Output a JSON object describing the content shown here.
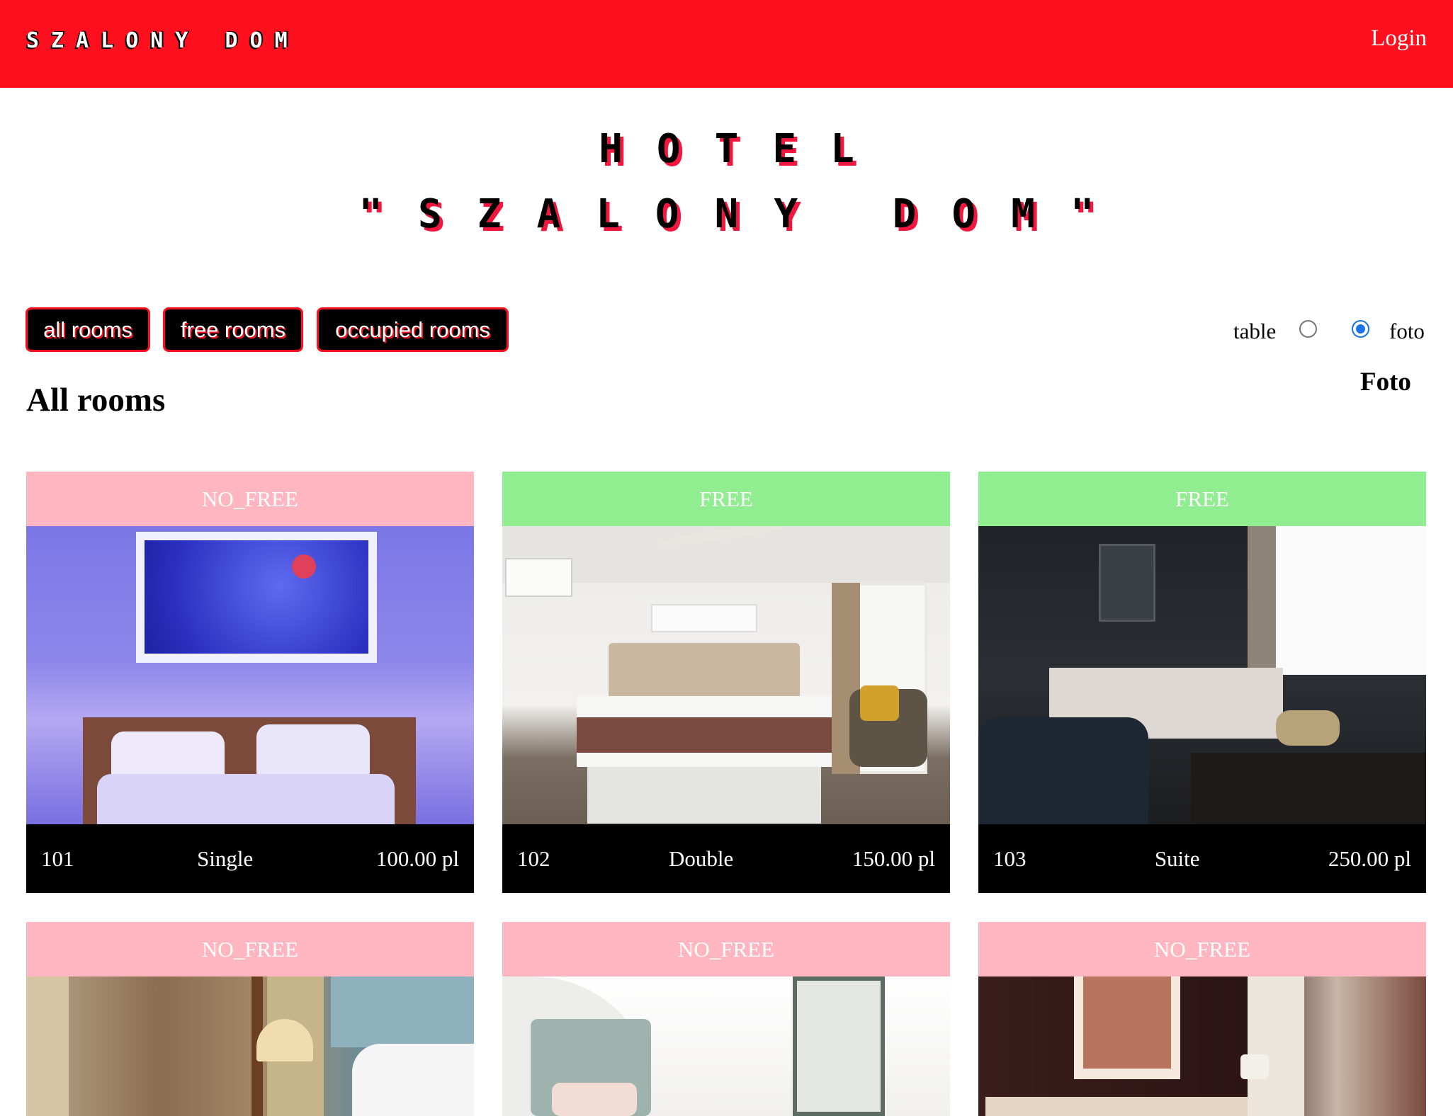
{
  "header": {
    "brand": "SZALONY DOM",
    "login_label": "Login"
  },
  "hero": {
    "line1": "HOTEL",
    "line2": "\"SZALONY DOM\""
  },
  "filters": {
    "all": "all rooms",
    "free": "free rooms",
    "occupied": "occupied rooms"
  },
  "view_toggle": {
    "table_label": "table",
    "foto_label": "foto",
    "selected": "foto",
    "title": "Foto"
  },
  "page_title": "All rooms",
  "colors": {
    "header": "#fd0f1d",
    "no_free": "#ffb6c1",
    "free": "#90ee90",
    "accent": "#1a73e8"
  },
  "rooms": [
    {
      "status": "NO_FREE",
      "number": "101",
      "type": "Single",
      "price": "100.00 pl"
    },
    {
      "status": "FREE",
      "number": "102",
      "type": "Double",
      "price": "150.00 pl"
    },
    {
      "status": "FREE",
      "number": "103",
      "type": "Suite",
      "price": "250.00 pl"
    },
    {
      "status": "NO_FREE"
    },
    {
      "status": "NO_FREE"
    },
    {
      "status": "NO_FREE"
    }
  ]
}
